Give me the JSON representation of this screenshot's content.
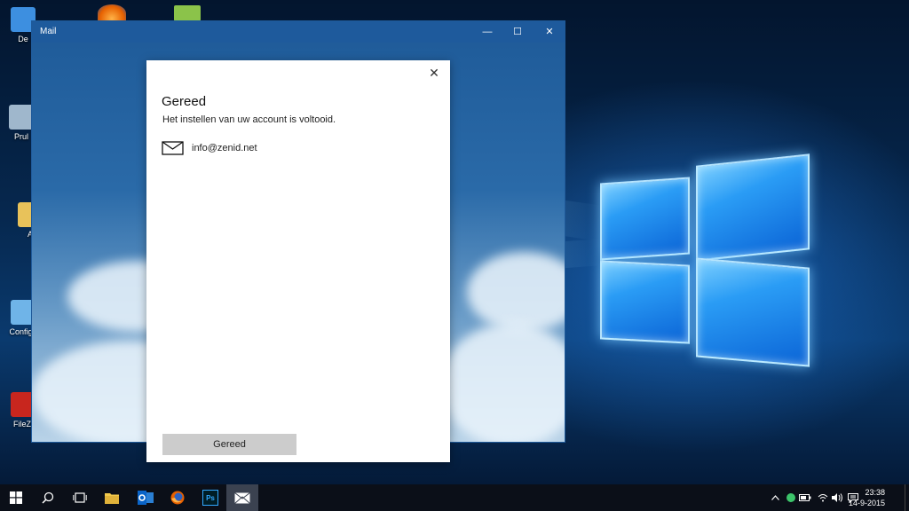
{
  "desktop": {
    "icons": [
      {
        "label": "De",
        "icon": "desktop-folder-icon",
        "color": "#3d8fe0"
      },
      {
        "label": "Prul",
        "icon": "recycle-bin-icon",
        "color": "#9fb7cc"
      },
      {
        "label": "A",
        "icon": "folder-icon",
        "color": "#e8c25a"
      },
      {
        "label": "Configu",
        "icon": "config-icon",
        "color": "#6fb4e8"
      },
      {
        "label": "FileZi",
        "icon": "filezilla-icon",
        "color": "#c8261e"
      }
    ],
    "top_icons": [
      {
        "icon": "firefox-icon",
        "color": "#e66000"
      },
      {
        "icon": "notepad-plus-icon",
        "color": "#8bc34a"
      }
    ]
  },
  "window": {
    "title": "Mail",
    "minimize_glyph": "—",
    "maximize_glyph": "☐",
    "close_glyph": "✕"
  },
  "dialog": {
    "close_glyph": "✕",
    "title": "Gereed",
    "subtitle": "Het instellen van uw account is voltooid.",
    "account_email": "info@zenid.net",
    "done_button_label": "Gereed"
  },
  "taskbar": {
    "apps": [
      {
        "name": "start",
        "icon": "windows-start-icon"
      },
      {
        "name": "search",
        "icon": "search-icon"
      },
      {
        "name": "task-view",
        "icon": "task-view-icon"
      },
      {
        "name": "file-explorer",
        "icon": "folder-icon",
        "color": "#f2c94c"
      },
      {
        "name": "outlook",
        "icon": "outlook-icon",
        "color": "#0a64c8"
      },
      {
        "name": "firefox",
        "icon": "firefox-icon",
        "color": "#e66000"
      },
      {
        "name": "photoshop",
        "icon": "photoshop-icon",
        "label": "Ps",
        "color": "#31a8ff"
      },
      {
        "name": "mail",
        "icon": "mail-icon",
        "active": true
      }
    ],
    "clock_time": "23:38",
    "clock_date": "14-9-2015"
  }
}
